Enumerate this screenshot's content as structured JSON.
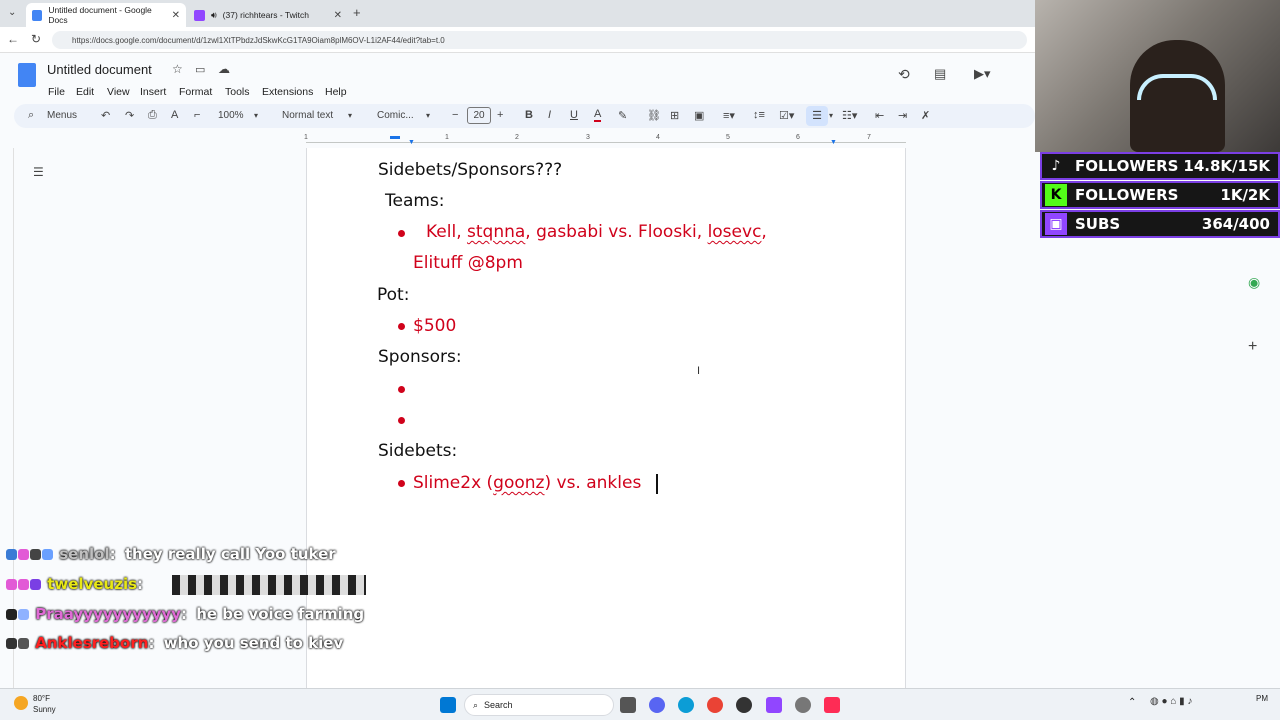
{
  "browser": {
    "tabs": [
      {
        "label": "Untitled document - Google Docs",
        "active": true
      },
      {
        "label": "(37) richhtears - Twitch",
        "active": false
      }
    ],
    "url": "https://docs.google.com/document/d/1zwl1XtTPbdzJdSkwKcG1TA9Oiam8plM6OV-L1i2AF44/edit?tab=t.0"
  },
  "docs": {
    "title": "Untitled document",
    "menus": [
      "File",
      "Edit",
      "View",
      "Insert",
      "Format",
      "Tools",
      "Extensions",
      "Help"
    ],
    "toolbar": {
      "search": "Menus",
      "zoom": "100%",
      "style": "Normal text",
      "font": "Comic...",
      "size": "20"
    },
    "ruler": [
      "1",
      "1",
      "2",
      "3",
      "4",
      "5",
      "6",
      "7"
    ]
  },
  "document": {
    "heading": "Sidebets/Sponsors???",
    "teams_label": "Teams:",
    "teams_line1_a": "Kell, ",
    "teams_line1_b": "stqnna",
    "teams_line1_c": ", gasbabi vs. Flooski, ",
    "teams_line1_d": "losevc",
    "teams_line1_e": ",",
    "teams_line2": "Elituff @8pm",
    "pot_label": "Pot:",
    "pot_value": "$500",
    "sponsors_label": "Sponsors:",
    "sidebets_label": "Sidebets:",
    "sidebet_a": "Slime2x (",
    "sidebet_b": "goonz",
    "sidebet_c": ") vs. ankles"
  },
  "overlay": {
    "stats": [
      {
        "label": "FOLLOWERS",
        "value": "14.8K/15K",
        "icon": "tiktok-icon",
        "color": "#ffffff"
      },
      {
        "label": "FOLLOWERS",
        "value": "1K/2K",
        "icon": "kick-icon",
        "color": "#53fc18"
      },
      {
        "label": "SUBS",
        "value": "364/400",
        "icon": "twitch-icon",
        "color": "#9146ff"
      }
    ],
    "chat": [
      {
        "user": "senlol",
        "color": "#bfbfbf",
        "msg": "they really call Yoo tuker"
      },
      {
        "user": "twelveuzis",
        "color": "#e8e815",
        "msg": ""
      },
      {
        "user": "Praayyyyyyyyyyy",
        "color": "#e06bd6",
        "msg": "he be voice farming"
      },
      {
        "user": "Anklesreborn",
        "color": "#ff2020",
        "msg": "who you send to kiev"
      }
    ]
  },
  "taskbar": {
    "weather_temp": "80°F",
    "weather_desc": "Sunny",
    "search": "Search",
    "clock": "PM"
  }
}
